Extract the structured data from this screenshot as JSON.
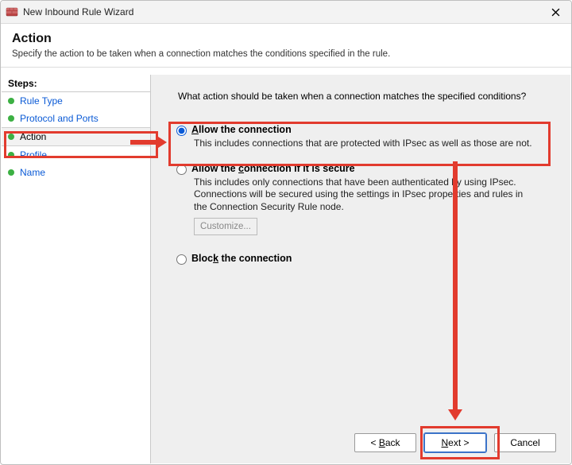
{
  "window": {
    "title": "New Inbound Rule Wizard"
  },
  "header": {
    "title": "Action",
    "subtitle": "Specify the action to be taken when a connection matches the conditions specified in the rule."
  },
  "sidebar": {
    "steps_label": "Steps:",
    "items": [
      {
        "label": "Rule Type",
        "selected": false
      },
      {
        "label": "Protocol and Ports",
        "selected": false
      },
      {
        "label": "Action",
        "selected": true
      },
      {
        "label": "Profile",
        "selected": false
      },
      {
        "label": "Name",
        "selected": false
      }
    ]
  },
  "main": {
    "prompt": "What action should be taken when a connection matches the specified conditions?",
    "options": {
      "allow": {
        "title": "Allow the connection",
        "description": "This includes connections that are protected with IPsec as well as those are not.",
        "checked": true
      },
      "allow_secure": {
        "title": "Allow the connection if it is secure",
        "description": "This includes only connections that have been authenticated by using IPsec.  Connections will be secured using the settings in IPsec properties and rules in the Connection Security Rule node.",
        "checked": false,
        "customize_label": "Customize..."
      },
      "block": {
        "title": "Block the connection",
        "checked": false
      }
    }
  },
  "buttons": {
    "back": "< Back",
    "next": "Next >",
    "cancel": "Cancel"
  }
}
